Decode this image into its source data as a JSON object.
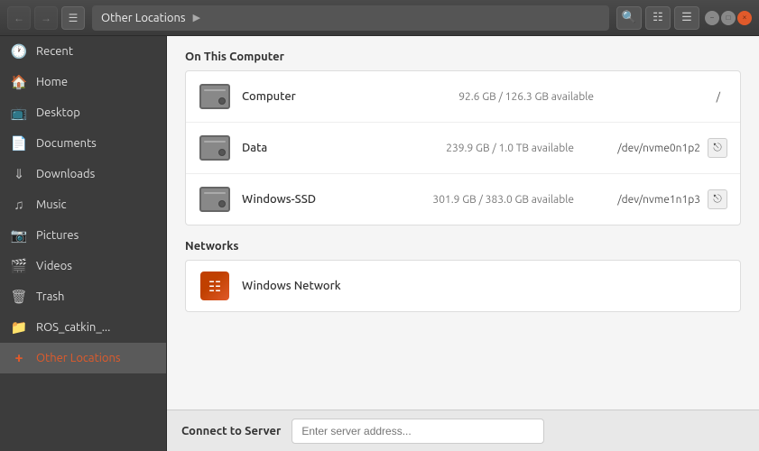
{
  "titlebar": {
    "title": "Other Locations",
    "breadcrumb": "Other Locations",
    "search_tooltip": "Search",
    "wc_close_label": "×",
    "wc_min_label": "−",
    "wc_max_label": "□"
  },
  "sidebar": {
    "items": [
      {
        "id": "recent",
        "label": "Recent",
        "icon": "🕐"
      },
      {
        "id": "home",
        "label": "Home",
        "icon": "🏠"
      },
      {
        "id": "desktop",
        "label": "Desktop",
        "icon": "📋"
      },
      {
        "id": "documents",
        "label": "Documents",
        "icon": "📁"
      },
      {
        "id": "downloads",
        "label": "Downloads",
        "icon": "⬇"
      },
      {
        "id": "music",
        "label": "Music",
        "icon": "♪"
      },
      {
        "id": "pictures",
        "label": "Pictures",
        "icon": "📷"
      },
      {
        "id": "videos",
        "label": "Videos",
        "icon": "🎬"
      },
      {
        "id": "trash",
        "label": "Trash",
        "icon": "🗑"
      },
      {
        "id": "ros_catkin",
        "label": "ROS_catkin_...",
        "icon": "📁"
      },
      {
        "id": "other_locations",
        "label": "Other Locations",
        "icon": "+"
      }
    ]
  },
  "content": {
    "on_this_computer_title": "On This Computer",
    "networks_title": "Networks",
    "drives": [
      {
        "name": "Computer",
        "info": "92.6 GB / 126.3 GB available",
        "path": "/",
        "has_eject": false
      },
      {
        "name": "Data",
        "info": "239.9 GB / 1.0 TB available",
        "path": "/dev/nvme0n1p2",
        "has_eject": true
      },
      {
        "name": "Windows-SSD",
        "info": "301.9 GB / 383.0 GB available",
        "path": "/dev/nvme1n1p3",
        "has_eject": true
      }
    ],
    "networks": [
      {
        "name": "Windows Network",
        "icon_type": "windows"
      }
    ],
    "connect_to_server_label": "Connect to Server",
    "connect_placeholder": "Enter server address..."
  }
}
